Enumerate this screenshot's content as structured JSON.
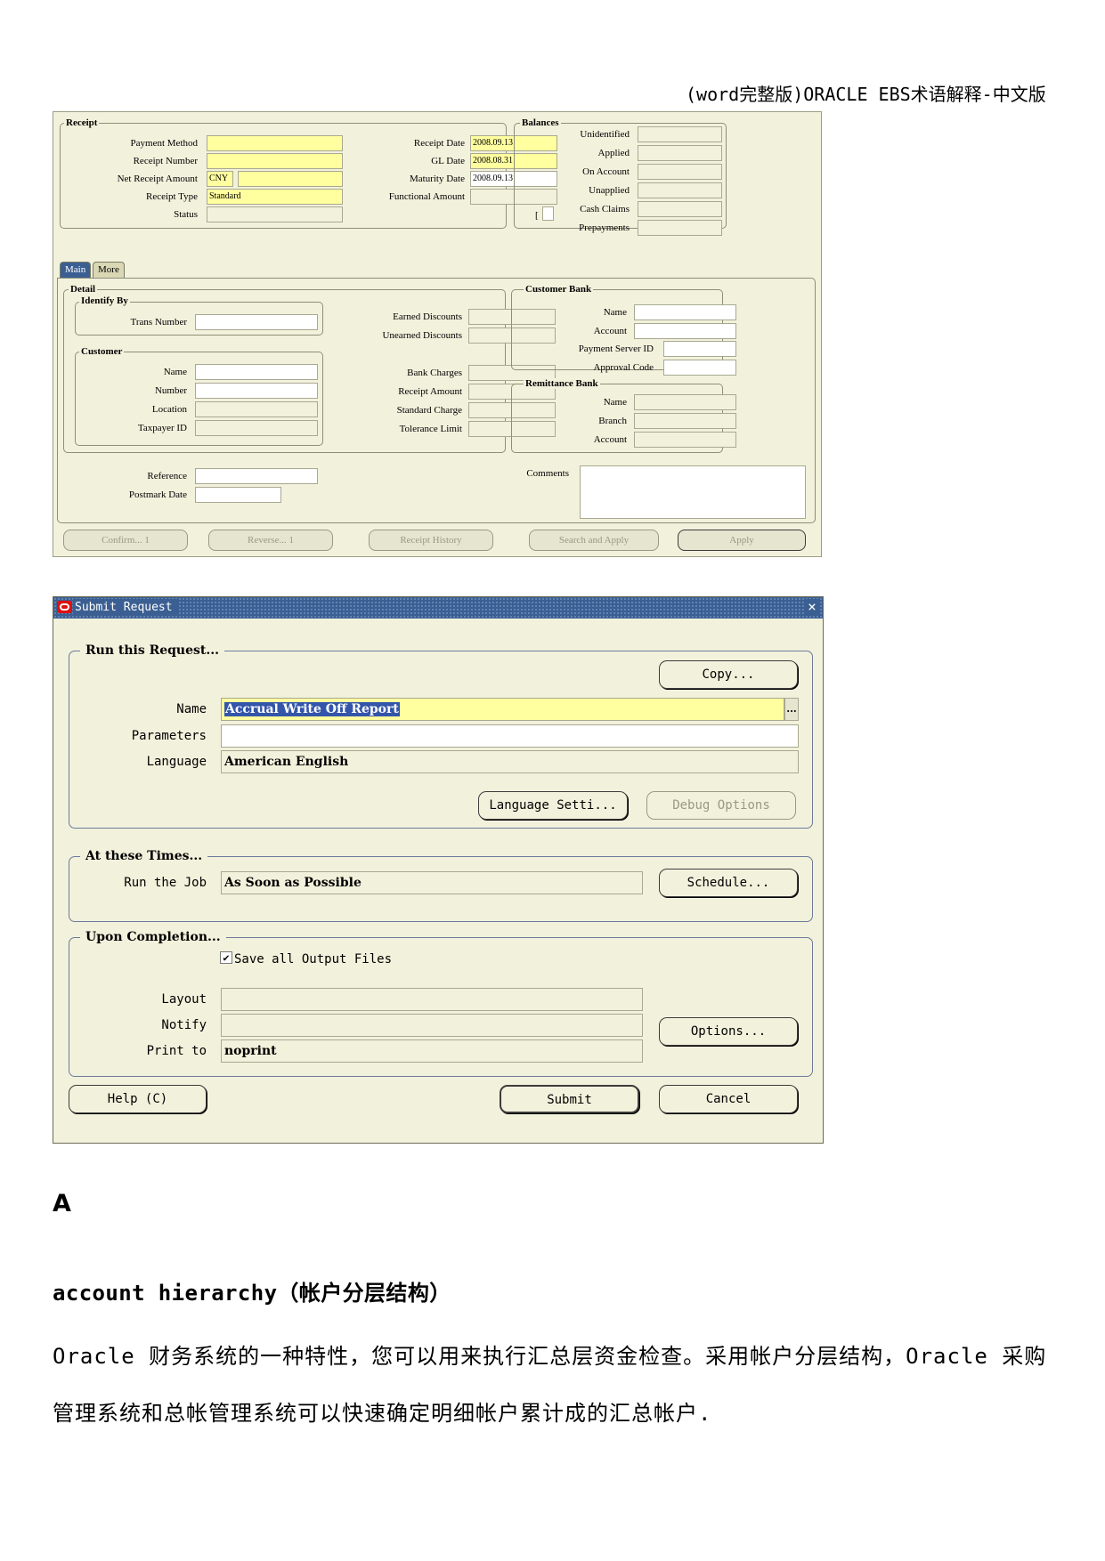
{
  "header": {
    "doc_title": "(word完整版)ORACLE EBS术语解释-中文版"
  },
  "receipt_form": {
    "receipt_legend": "Receipt",
    "payment_method": "Payment Method",
    "receipt_number": "Receipt Number",
    "net_receipt_amount": "Net Receipt Amount",
    "currency": "CNY",
    "receipt_type": "Receipt Type",
    "receipt_type_value": "Standard",
    "status": "Status",
    "receipt_date": "Receipt Date",
    "receipt_date_value": "2008.09.13",
    "gl_date": "GL Date",
    "gl_date_value": "2008.08.31",
    "maturity_date": "Maturity Date",
    "maturity_date_value": "2008.09.13",
    "functional_amount": "Functional Amount",
    "bracket": "[",
    "balances_legend": "Balances",
    "unidentified": "Unidentified",
    "applied": "Applied",
    "on_account": "On Account",
    "unapplied": "Unapplied",
    "cash_claims": "Cash Claims",
    "prepayments": "Prepayments",
    "tab_main": "Main",
    "tab_more": "More",
    "detail_legend": "Detail",
    "identify_by": "Identify By",
    "trans_number": "Trans Number",
    "customer_legend": "Customer",
    "name": "Name",
    "number": "Number",
    "location": "Location",
    "taxpayer_id": "Taxpayer ID",
    "earned_discounts": "Earned Discounts",
    "unearned_discounts": "Unearned Discounts",
    "bank_charges": "Bank Charges",
    "receipt_amount": "Receipt Amount",
    "standard_charge": "Standard Charge",
    "tolerance_limit": "Tolerance Limit",
    "customer_bank_legend": "Customer Bank",
    "cb_name": "Name",
    "cb_account": "Account",
    "payment_server_id": "Payment Server ID",
    "approval_code": "Approval Code",
    "remittance_bank_legend": "Remittance Bank",
    "rb_name": "Name",
    "rb_branch": "Branch",
    "rb_account": "Account",
    "reference": "Reference",
    "postmark_date": "Postmark Date",
    "comments": "Comments",
    "btn_confirm": "Confirm... 1",
    "btn_reverse": "Reverse... 1",
    "btn_receipt_history": "Receipt History",
    "btn_search_apply": "Search and Apply",
    "btn_apply": "Apply"
  },
  "submit_request": {
    "title": "Submit Request",
    "close": "×",
    "run_legend": "Run this Request...",
    "copy_button": "Copy...",
    "name_label": "Name",
    "name_value": "Accrual Write Off Report",
    "lov_button": "...",
    "parameters_label": "Parameters",
    "parameters_value": "",
    "language_label": "Language",
    "language_value": "American English",
    "language_settings_button": "Language Setti...",
    "debug_options_button": "Debug Options",
    "times_legend": "At these Times...",
    "run_job_label": "Run the Job",
    "run_job_value": "As Soon as Possible",
    "schedule_button": "Schedule...",
    "completion_legend": "Upon Completion...",
    "save_output_label": "Save all Output Files",
    "checkbox_mark": "✔",
    "layout_label": "Layout",
    "notify_label": "Notify",
    "print_to_label": "Print to",
    "print_to_value": "noprint",
    "options_button": "Options...",
    "help_button": "Help (C)",
    "submit_button": "Submit",
    "cancel_button": "Cancel"
  },
  "body": {
    "section_letter": "A",
    "term": "account hierarchy（帐户分层结构）",
    "definition": "Oracle 财务系统的一种特性，您可以用来执行汇总层资金检查。采用帐户分层结构，Oracle 采购管理系统和总帐管理系统可以快速确定明细帐户累计成的汇总帐户."
  }
}
